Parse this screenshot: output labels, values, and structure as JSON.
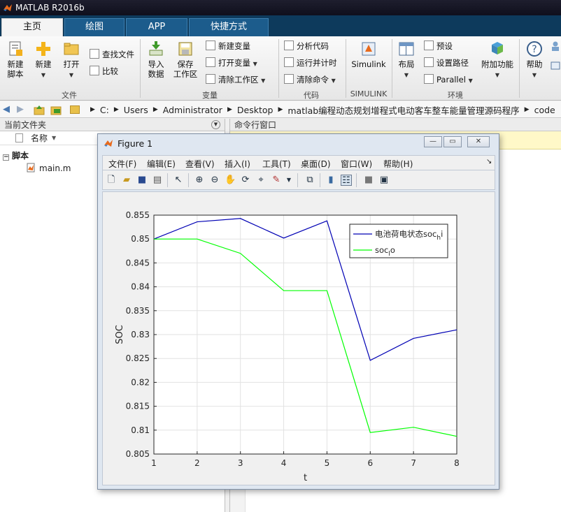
{
  "window": {
    "title": "MATLAB R2016b"
  },
  "tabs": [
    {
      "label": "主页",
      "active": true
    },
    {
      "label": "绘图",
      "active": false
    },
    {
      "label": "APP",
      "active": false
    },
    {
      "label": "快捷方式",
      "active": false
    }
  ],
  "ribbon": {
    "new_script": [
      "新建",
      "脚本"
    ],
    "new": "新建",
    "open": "打开",
    "find_files": "查找文件",
    "compare": "比较",
    "import": [
      "导入",
      "数据"
    ],
    "save_workspace": [
      "保存",
      "工作区"
    ],
    "new_variable": "新建变量",
    "open_variable": "打开变量",
    "clear_workspace": "清除工作区",
    "analyze_code": "分析代码",
    "run_and_time": "运行并计时",
    "clear_commands": "清除命令",
    "simulink": "Simulink",
    "layout": "布局",
    "preferences": "预设",
    "set_path": "设置路径",
    "parallel": "Parallel",
    "addons": "附加功能",
    "help": "帮助",
    "groups": {
      "file": "文件",
      "variable": "变量",
      "code": "代码",
      "simulink": "SIMULINK",
      "environment": "环境"
    }
  },
  "address": {
    "crumbs": [
      "C:",
      "Users",
      "Administrator",
      "Desktop",
      "matlab编程动态规划增程式电动客车整车能量管理源码程序",
      "code"
    ]
  },
  "current_folder": {
    "title": "当前文件夹",
    "column_name": "名称",
    "group_label": "脚本",
    "files": [
      "main.m"
    ]
  },
  "command_window": {
    "title": "命令行窗口"
  },
  "figure": {
    "title": "Figure 1",
    "menus": [
      "文件(F)",
      "编辑(E)",
      "查看(V)",
      "插入(I)",
      "工具(T)",
      "桌面(D)",
      "窗口(W)",
      "帮助(H)"
    ]
  },
  "chart_data": {
    "type": "line",
    "title": "",
    "xlabel": "t",
    "ylabel": "SOC",
    "x": [
      1,
      2,
      3,
      4,
      5,
      6,
      7,
      8
    ],
    "xlim": [
      1,
      8
    ],
    "ylim": [
      0.805,
      0.855
    ],
    "xticks": [
      "1",
      "2",
      "3",
      "4",
      "5",
      "6",
      "7",
      "8"
    ],
    "yticks": [
      "0.805",
      "0.81",
      "0.815",
      "0.82",
      "0.825",
      "0.83",
      "0.835",
      "0.84",
      "0.845",
      "0.85",
      "0.855"
    ],
    "grid": true,
    "legend_position": "top-right",
    "series": [
      {
        "name": "电池荷电状态soc_hi",
        "legend_main": "电池荷电状态soc",
        "legend_sub": "h",
        "legend_tail": "i",
        "color": "#0000b4",
        "values": [
          0.85,
          0.8536,
          0.8543,
          0.8502,
          0.8538,
          0.8246,
          0.8292,
          0.831
        ]
      },
      {
        "name": "soc_lo",
        "legend_main": "soc",
        "legend_sub": "l",
        "legend_tail": "o",
        "color": "#00ff00",
        "values": [
          0.85,
          0.85,
          0.847,
          0.8392,
          0.8392,
          0.8095,
          0.8106,
          0.8087
        ]
      }
    ]
  }
}
